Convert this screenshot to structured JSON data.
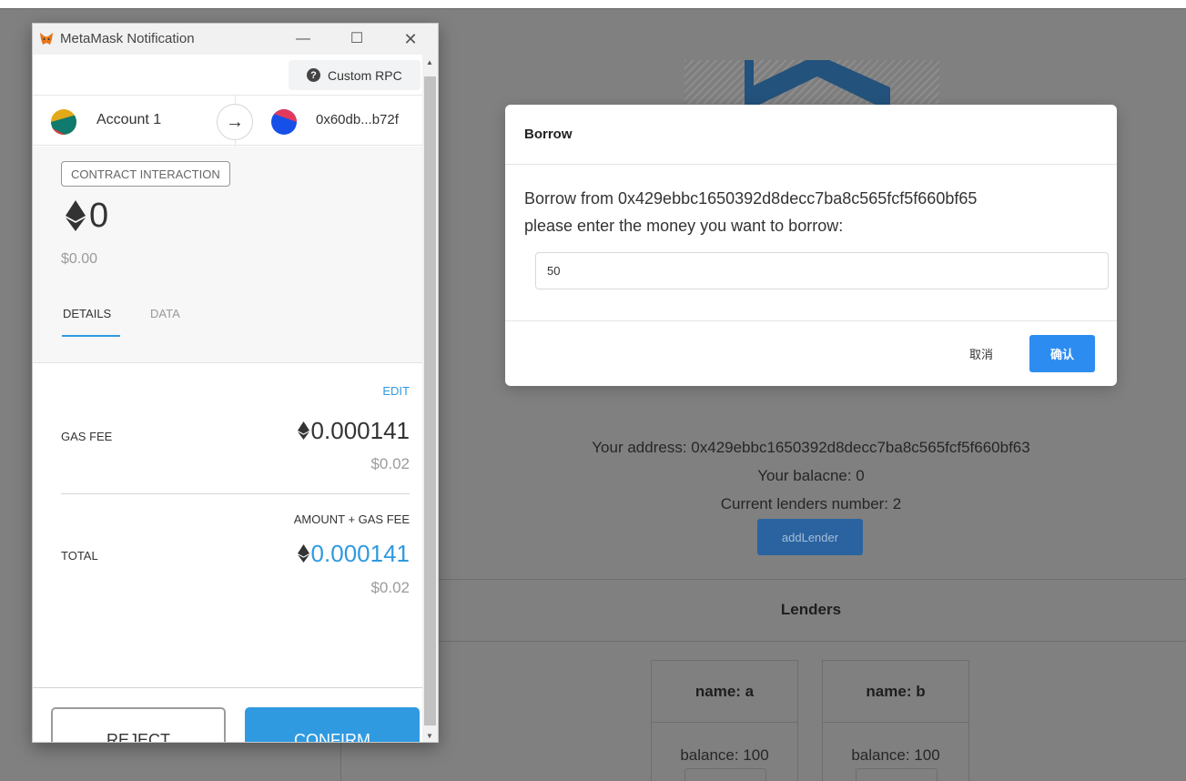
{
  "metamask": {
    "window_title": "MetaMask Notification",
    "window_buttons": {
      "minimize": "—",
      "maximize": "☐",
      "close": "✕"
    },
    "network": "Custom RPC",
    "from_account": "Account 1",
    "to_address": "0x60db...b72f",
    "contract_badge": "CONTRACT INTERACTION",
    "amount_eth": "0",
    "amount_usd": "$0.00",
    "tabs": {
      "details": "DETAILS",
      "data": "DATA"
    },
    "edit_label": "EDIT",
    "gas_fee_label": "GAS FEE",
    "gas_fee_eth": "0.000141",
    "gas_fee_usd": "$0.02",
    "amount_plus_gas_label": "AMOUNT + GAS FEE",
    "total_label": "TOTAL",
    "total_eth": "0.000141",
    "total_usd": "$0.02",
    "reject_label": "REJECT",
    "confirm_label": "CONFIRM",
    "colors": {
      "accent": "#2f9ae0"
    }
  },
  "modal": {
    "title": "Borrow",
    "body_line1": "Borrow from 0x429ebbc1650392d8decc7ba8c565fcf5f660bf65",
    "body_line2": "please enter the money you want to borrow:",
    "input_value": "50",
    "cancel_label": "取消",
    "ok_label": "确认",
    "colors": {
      "primary": "#2d8cf0"
    }
  },
  "page": {
    "your_address": "Your address: 0x429ebbc1650392d8decc7ba8c565fcf5f660bf63",
    "your_balance": "Your balacne: 0",
    "lenders_number": "Current lenders number: 2",
    "add_lender_label": "addLender",
    "lenders_title": "Lenders",
    "lenders": [
      {
        "name": "name: a",
        "balance": "balance: 100"
      },
      {
        "name": "name: b",
        "balance": "balance: 100"
      }
    ]
  }
}
